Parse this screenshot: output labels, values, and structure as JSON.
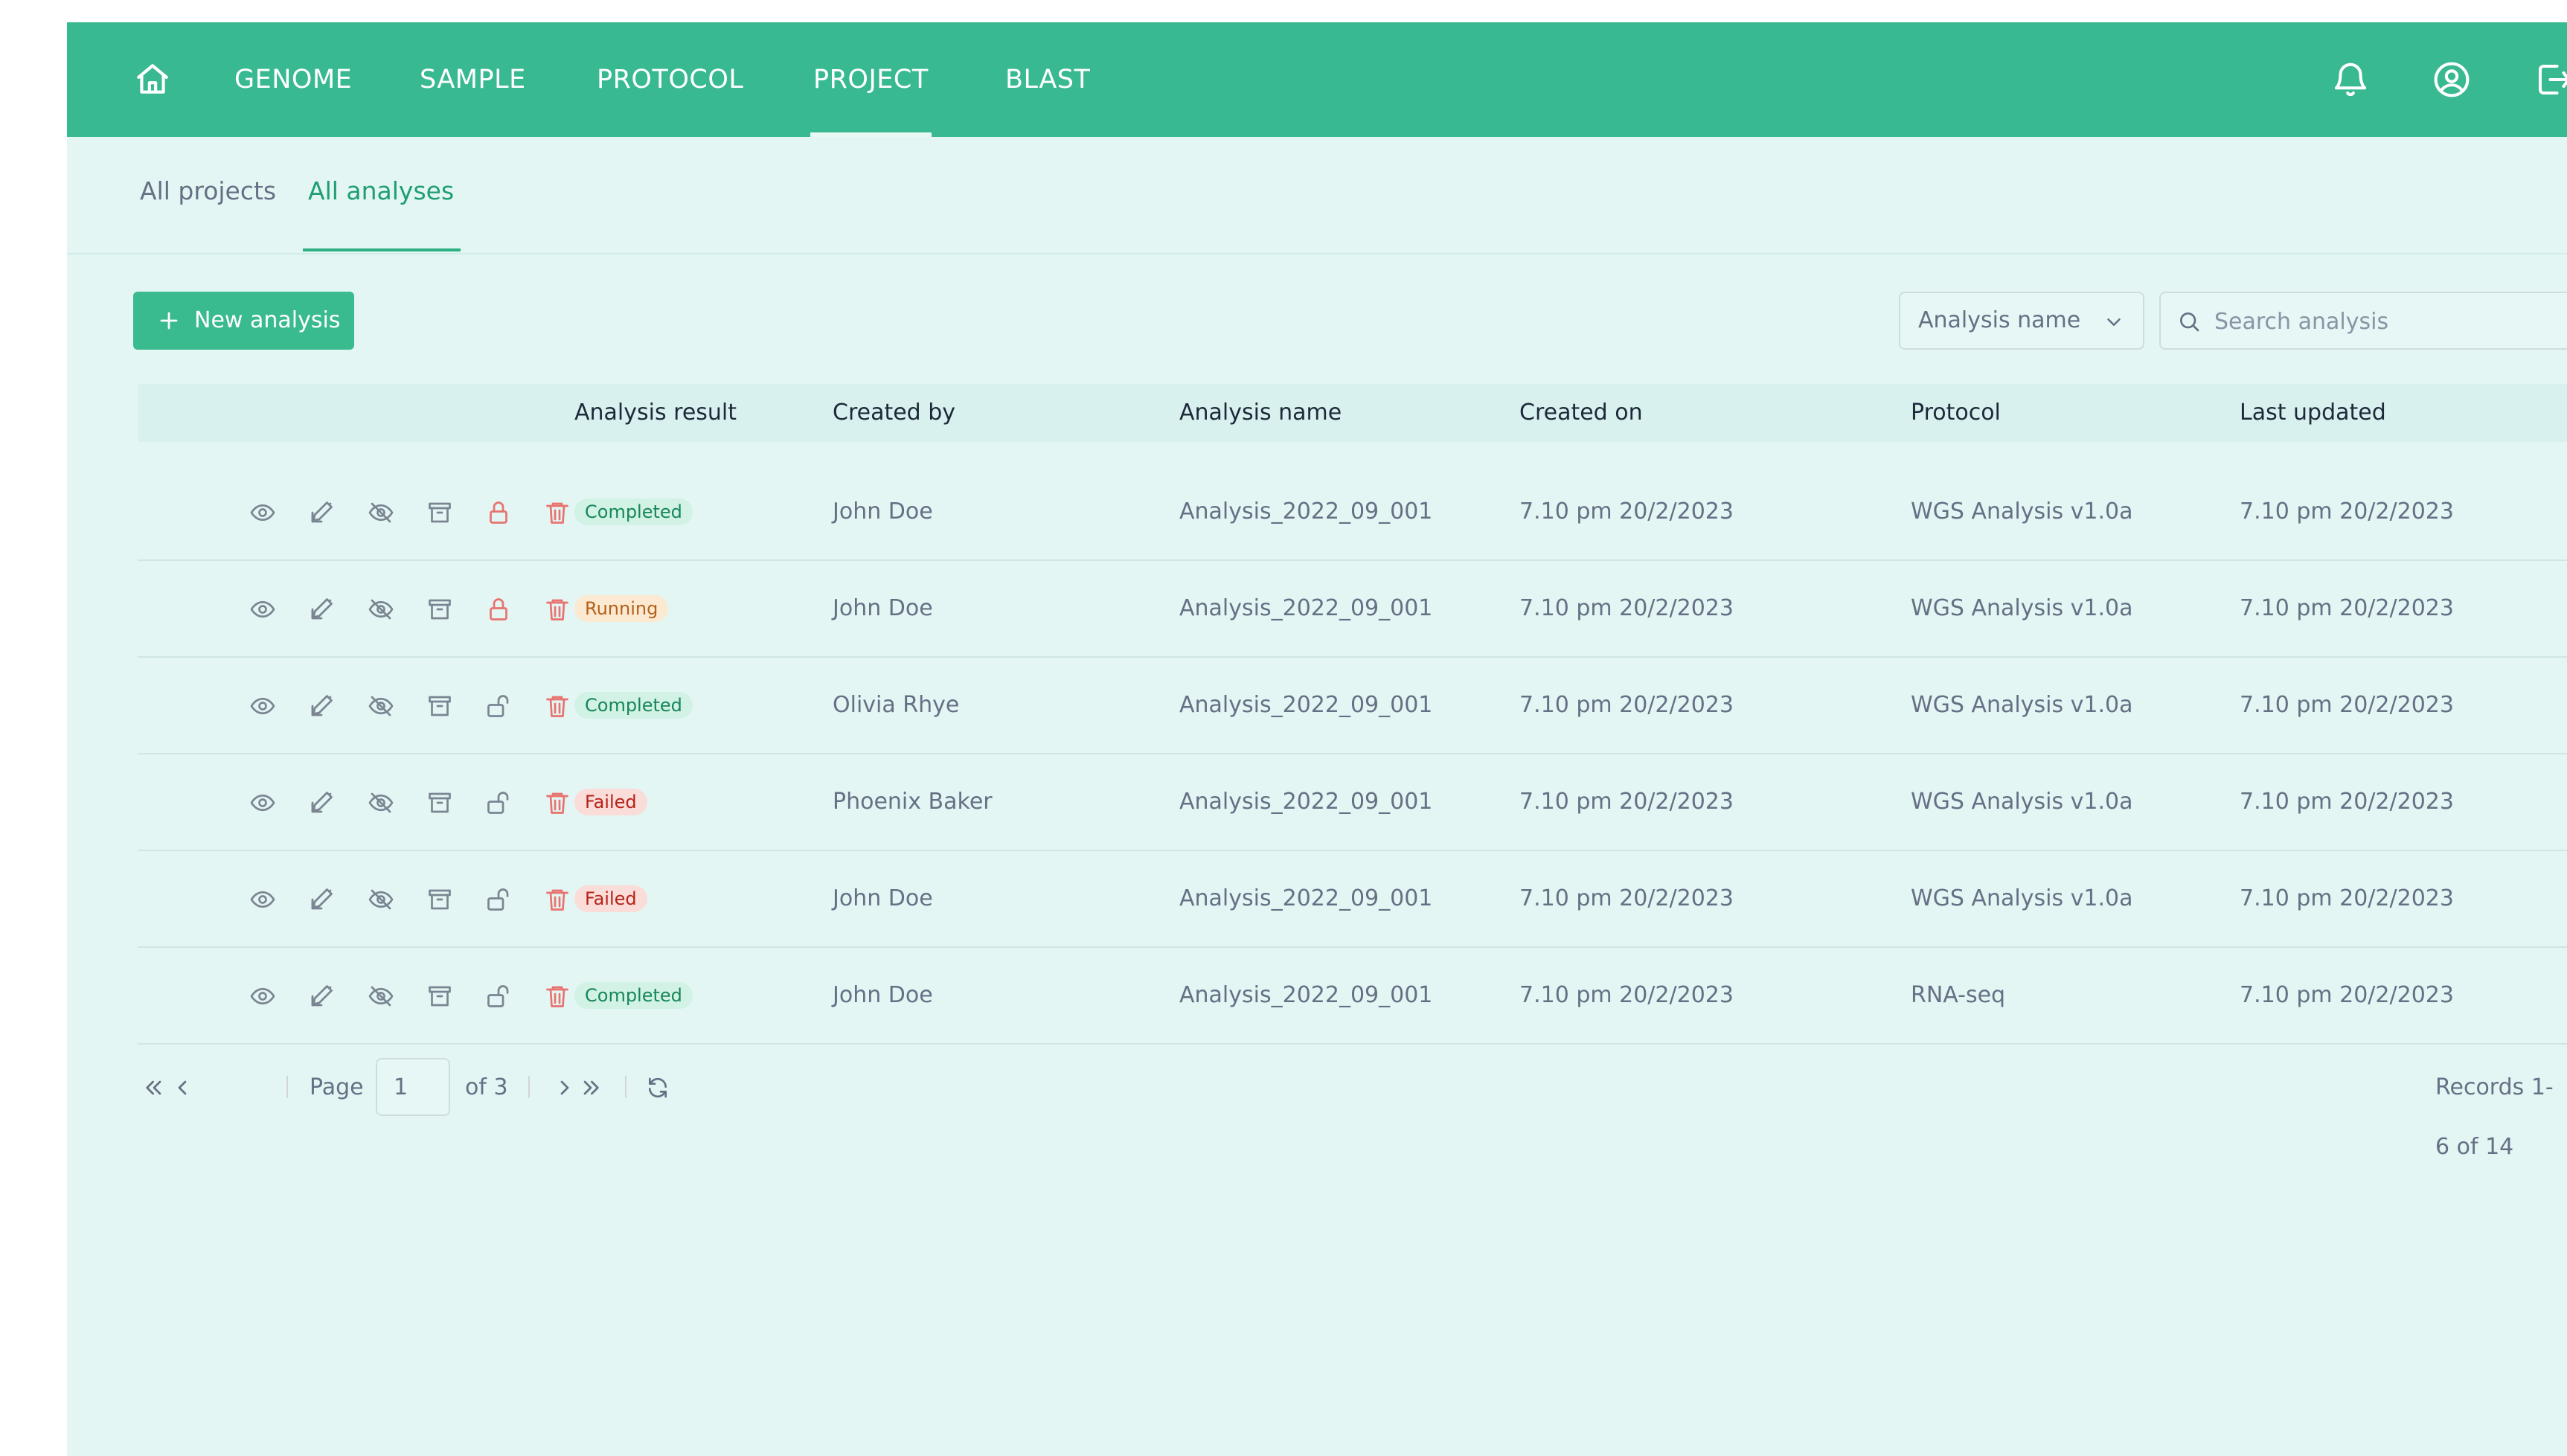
{
  "nav": {
    "items": [
      "GENOME",
      "SAMPLE",
      "PROTOCOL",
      "PROJECT",
      "BLAST"
    ],
    "active": "PROJECT",
    "icons": [
      "home-icon",
      "bell-icon",
      "user-circle-icon",
      "logout-icon"
    ]
  },
  "subtabs": {
    "items": [
      "All projects",
      "All analyses"
    ],
    "active": "All analyses"
  },
  "toolbar": {
    "new_label": "New analysis",
    "filter_value": "Analysis name",
    "search_placeholder": "Search analysis"
  },
  "table": {
    "columns": [
      "Analysis result",
      "Created by",
      "Analysis name",
      "Created on",
      "Protocol",
      "Last updated"
    ],
    "action_icons": [
      "eye-icon",
      "edit-icon",
      "eye-off-icon",
      "archive-icon",
      "lock-icon",
      "trash-icon"
    ],
    "rows": [
      {
        "status": "Completed",
        "status_type": "completed",
        "locked": true,
        "created_by": "John Doe",
        "name": "Analysis_2022_09_001",
        "created_on": "7.10 pm 20/2/2023",
        "protocol": "WGS Analysis v1.0a",
        "updated": "7.10 pm 20/2/2023"
      },
      {
        "status": "Running",
        "status_type": "running",
        "locked": true,
        "created_by": "John Doe",
        "name": "Analysis_2022_09_001",
        "created_on": "7.10 pm 20/2/2023",
        "protocol": "WGS Analysis v1.0a",
        "updated": "7.10 pm 20/2/2023"
      },
      {
        "status": "Completed",
        "status_type": "completed",
        "locked": false,
        "created_by": "Olivia Rhye",
        "name": "Analysis_2022_09_001",
        "created_on": "7.10 pm 20/2/2023",
        "protocol": "WGS Analysis v1.0a",
        "updated": "7.10 pm 20/2/2023"
      },
      {
        "status": "Failed",
        "status_type": "failed",
        "locked": false,
        "created_by": "Phoenix Baker",
        "name": "Analysis_2022_09_001",
        "created_on": "7.10 pm 20/2/2023",
        "protocol": "WGS Analysis v1.0a",
        "updated": "7.10 pm 20/2/2023"
      },
      {
        "status": "Failed",
        "status_type": "failed",
        "locked": false,
        "created_by": "John Doe",
        "name": "Analysis_2022_09_001",
        "created_on": "7.10 pm 20/2/2023",
        "protocol": "WGS Analysis v1.0a",
        "updated": "7.10 pm 20/2/2023"
      },
      {
        "status": "Completed",
        "status_type": "completed",
        "locked": false,
        "created_by": "John Doe",
        "name": "Analysis_2022_09_001",
        "created_on": "7.10 pm 20/2/2023",
        "protocol": "RNA-seq",
        "updated": "7.10 pm 20/2/2023"
      }
    ]
  },
  "pagination": {
    "page_label": "Page",
    "page_value": "1",
    "of_label": "of 3",
    "records": "Records 1-6 of 14"
  },
  "colors": {
    "brand": "#38b991",
    "background": "#e3f6f4",
    "completed": "#17875a",
    "running": "#b5611a",
    "failed": "#b42318",
    "lock_trash": "#e8736f"
  }
}
